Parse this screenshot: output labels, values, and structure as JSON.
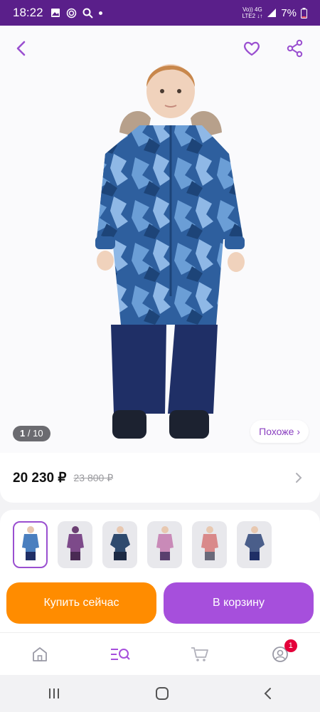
{
  "status_bar": {
    "time": "18:22",
    "network_top": "Vo)) 4G",
    "network_bottom": "LTE2 ↓↑",
    "battery": "7%"
  },
  "product": {
    "image_counter_current": "1",
    "image_counter_total": "/ 10",
    "similar_label": "Похоже ›",
    "price": "20 230 ₽",
    "old_price": "23 800 ₽",
    "thumbnails": [
      "blue",
      "purple",
      "navy",
      "pink",
      "coral",
      "dark-blue"
    ]
  },
  "actions": {
    "buy_now": "Купить сейчас",
    "add_to_cart": "В корзину"
  },
  "tabbar": {
    "cart_badge": "1"
  },
  "colors": {
    "brand_purple": "#a64fdc",
    "buy_orange": "#ff8c00",
    "status_bar": "#5a1f8a"
  }
}
